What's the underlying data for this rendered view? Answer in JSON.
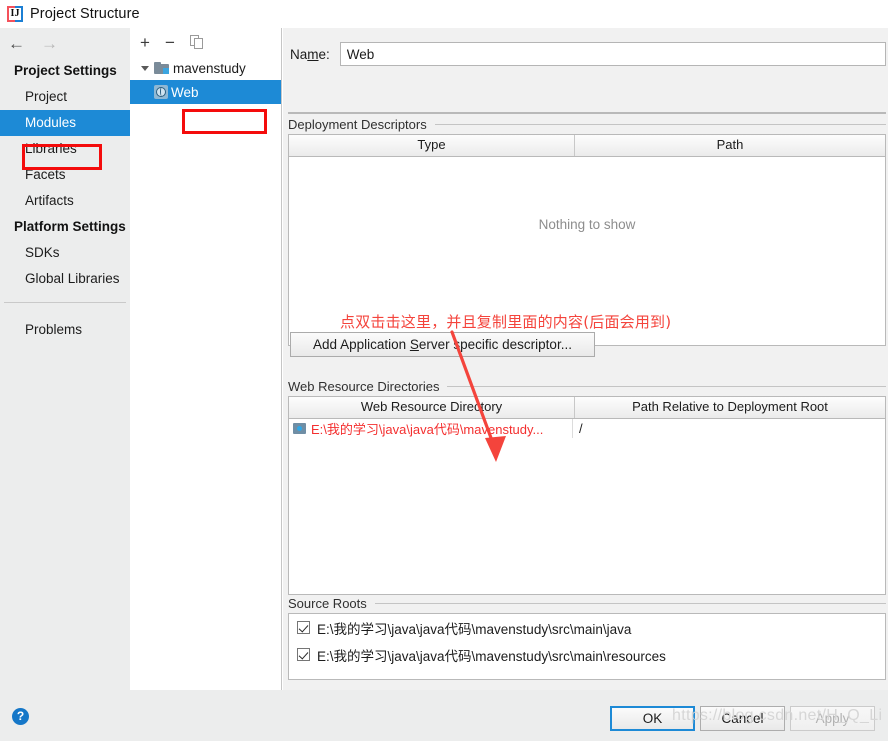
{
  "window": {
    "title": "Project Structure",
    "app_icon": "intellij-idea-icon",
    "icon_glyph": "IJ"
  },
  "navigation": {
    "back_icon": "arrow-left-icon",
    "forward_icon": "arrow-right-icon"
  },
  "sidebar": {
    "groups": [
      {
        "title": "Project Settings",
        "items": [
          {
            "label": "Project",
            "selected": false
          },
          {
            "label": "Modules",
            "selected": true
          },
          {
            "label": "Libraries",
            "selected": false
          },
          {
            "label": "Facets",
            "selected": false
          },
          {
            "label": "Artifacts",
            "selected": false
          }
        ]
      },
      {
        "title": "Platform Settings",
        "items": [
          {
            "label": "SDKs",
            "selected": false
          },
          {
            "label": "Global Libraries",
            "selected": false
          }
        ]
      }
    ],
    "footer_items": [
      {
        "label": "Problems",
        "selected": false
      }
    ]
  },
  "tree_panel": {
    "toolbar": {
      "add_label": "+",
      "remove_label": "−",
      "copy_icon": "copy-icon"
    },
    "nodes": [
      {
        "label": "mavenstudy",
        "icon": "folder-module-icon",
        "expanded": true,
        "selected": false
      },
      {
        "label": "Web",
        "icon": "web-facet-icon",
        "expanded": false,
        "selected": true
      }
    ]
  },
  "content": {
    "name_field": {
      "label_before": "Na",
      "label_mnemonic": "m",
      "label_after": "e:",
      "value": "Web",
      "placeholder": ""
    },
    "deployment_descriptors": {
      "section_title": "Deployment Descriptors",
      "columns": [
        "Type",
        "Path"
      ],
      "rows": [],
      "empty_text": "Nothing to show"
    },
    "add_descriptor_button": {
      "text_before": "Add Application ",
      "text_mnemonic": "S",
      "text_after": "erver specific descriptor..."
    },
    "web_resource_directories": {
      "section_title": "Web Resource Directories",
      "columns": [
        "Web Resource Directory",
        "Path Relative to Deployment Root"
      ],
      "rows": [
        {
          "directory": "E:\\我的学习\\java\\java代码\\mavenstudy...",
          "relative_path": "/",
          "icon": "directory-icon"
        }
      ]
    },
    "source_roots": {
      "section_title": "Source Roots",
      "rows": [
        {
          "path": "E:\\我的学习\\java\\java代码\\mavenstudy\\src\\main\\java",
          "checked": true
        },
        {
          "path": "E:\\我的学习\\java\\java代码\\mavenstudy\\src\\main\\resources",
          "checked": true
        }
      ]
    }
  },
  "annotations": {
    "note_text": "点双击击这里，并且复制里面的内容(后面会用到)",
    "note_color": "#f4443c",
    "highlight_color": "#f40c0c",
    "arrow_icon": "red-arrow-icon"
  },
  "footer": {
    "help_label": "?",
    "ok_label": "OK",
    "cancel_label": "Cancel",
    "apply_label": "Apply"
  },
  "watermark": {
    "text": "https://blog.csdn.net/H_Q_Li"
  }
}
